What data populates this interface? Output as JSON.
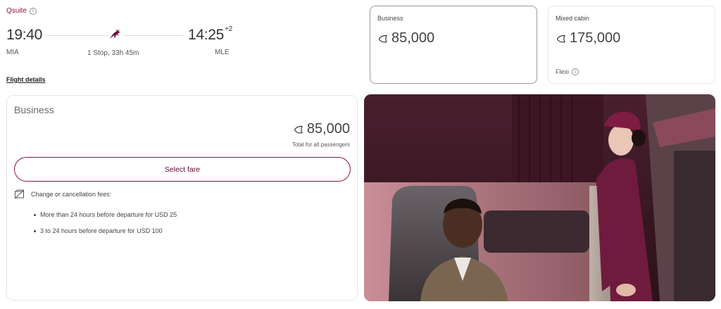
{
  "flight": {
    "product": "Qsuite",
    "departure_time": "19:40",
    "arrival_time": "14:25",
    "day_offset": "+2",
    "origin": "MIA",
    "destination": "MLE",
    "stops_duration": "1 Stop, 33h 45m",
    "details_link": "Flight details"
  },
  "fare_options": [
    {
      "cabin": "Business",
      "price": "85,000",
      "selected": true
    },
    {
      "cabin": "Mixed cabin",
      "price": "175,000",
      "fare_family": "Flexi"
    }
  ],
  "detail": {
    "cabin": "Business",
    "price": "85,000",
    "total_note": "Total for all passengers",
    "select_label": "Select fare",
    "fees_title": "Change or cancellation fees:",
    "fees": [
      "More than 24 hours before departure for USD 25",
      "3 to 24 hours before departure for USD 100"
    ]
  },
  "colors": {
    "brand": "#5c0632",
    "accent": "#8a1538"
  },
  "icons": {
    "info": "info-icon",
    "airline": "qatar-oryx-logo-icon",
    "avios": "avios-icon",
    "fees": "no-change-fee-icon"
  }
}
